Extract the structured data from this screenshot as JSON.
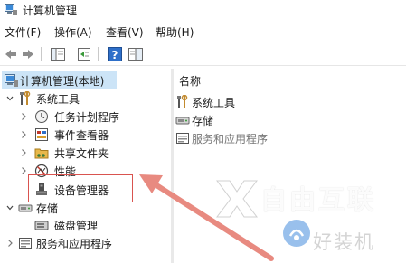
{
  "window": {
    "title": "计算机管理"
  },
  "menu": [
    "文件(F)",
    "操作(A)",
    "查看(V)",
    "帮助(H)"
  ],
  "toolbar": {
    "buttons": [
      "back-icon",
      "forward-icon",
      "show-tree-icon",
      "properties-icon",
      "help-icon",
      "panel-icon"
    ]
  },
  "tree": {
    "root": {
      "label": "计算机管理(本地)",
      "icon": "computer-management-icon"
    },
    "items": [
      {
        "label": "系统工具",
        "icon": "system-tools-icon",
        "expanded": true
      },
      {
        "label": "任务计划程序",
        "icon": "clock-icon"
      },
      {
        "label": "事件查看器",
        "icon": "event-viewer-icon"
      },
      {
        "label": "共享文件夹",
        "icon": "shared-folder-icon"
      },
      {
        "label": "性能",
        "icon": "performance-icon"
      },
      {
        "label": "设备管理器",
        "icon": "device-manager-icon",
        "highlighted": true
      },
      {
        "label": "存储",
        "icon": "storage-icon",
        "expanded": true
      },
      {
        "label": "磁盘管理",
        "icon": "disk-icon"
      },
      {
        "label": "服务和应用程序",
        "icon": "services-icon"
      }
    ]
  },
  "list": {
    "column_header": "名称",
    "items": [
      {
        "label": "系统工具",
        "icon": "system-tools-icon"
      },
      {
        "label": "存储",
        "icon": "storage-icon"
      },
      {
        "label": "服务和应用程序",
        "icon": "services-icon"
      }
    ]
  },
  "watermarks": {
    "brand": "自由互联",
    "site": "好装机"
  },
  "colors": {
    "highlight_box": "#d9534f",
    "arrow": "#e88a80",
    "selection": "#cce4f7"
  }
}
